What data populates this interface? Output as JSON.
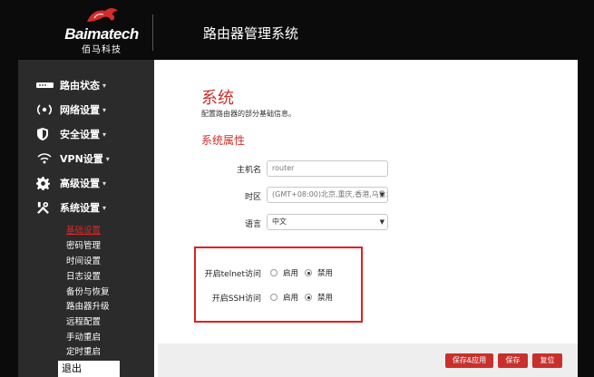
{
  "header": {
    "brand": "Baimatech",
    "brand_cn": "佰马科技",
    "title": "路由器管理系统"
  },
  "sidebar": {
    "items": [
      {
        "label": "路由状态",
        "icon": "router-status-icon",
        "caret": "▾"
      },
      {
        "label": "网络设置",
        "icon": "network-icon",
        "caret": "▾"
      },
      {
        "label": "安全设置",
        "icon": "shield-icon",
        "caret": "▾"
      },
      {
        "label": "VPN设置",
        "icon": "wifi-signal-icon",
        "caret": "▾"
      },
      {
        "label": "高级设置",
        "icon": "gear-icon",
        "caret": "▾"
      },
      {
        "label": "系统设置",
        "icon": "tools-icon",
        "caret": "▾"
      }
    ],
    "sub_items": [
      {
        "label": "基础设置"
      },
      {
        "label": "密码管理"
      },
      {
        "label": "时间设置"
      },
      {
        "label": "日志设置"
      },
      {
        "label": "备份与恢复"
      },
      {
        "label": "路由器升级"
      },
      {
        "label": "远程配置"
      },
      {
        "label": "手动重启"
      },
      {
        "label": "定时重启"
      }
    ],
    "logout": "退出"
  },
  "main": {
    "title": "系统",
    "description": "配置路由器的部分基础信息。",
    "section": "系统属性",
    "hostname_label": "主机名",
    "hostname_placeholder": "router",
    "timezone_label": "时区",
    "timezone_value": "(GMT+08:00)北京,重庆,香港,乌鲁木齐",
    "language_label": "语言",
    "language_value": "中文",
    "telnet_label": "开启telnet访问",
    "ssh_label": "开启SSH访问",
    "enable_label": "启用",
    "disable_label": "禁用",
    "telnet_selected": "禁用",
    "ssh_selected": "禁用"
  },
  "buttons": {
    "save_apply": "保存&应用",
    "save": "保存",
    "reset": "复位"
  },
  "colors": {
    "accent": "#c9302c",
    "highlight_border": "#e02020",
    "sidebar_bg": "#2b2b2b",
    "header_bg": "#0b0b0b"
  }
}
